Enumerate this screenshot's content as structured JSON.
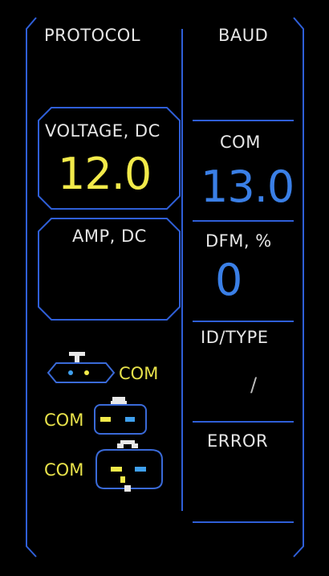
{
  "colors": {
    "frame": "#2f5fd8",
    "voltage_value": "#f2ea4a",
    "com_value": "#3a7fe6",
    "dfm_value": "#3a7fe6",
    "connector_label": "#e8e24a",
    "pin_yellow": "#f2ea4a",
    "pin_blue": "#3fa0ee"
  },
  "header": {
    "protocol_label": "PROTOCOL",
    "baud_label": "BAUD"
  },
  "voltage": {
    "label": "VOLTAGE, DC",
    "value": "12.0"
  },
  "amp": {
    "label": "AMP, DC"
  },
  "com": {
    "label": "COM",
    "value": "13.0"
  },
  "dfm": {
    "label": "DFM, %",
    "value": "0"
  },
  "id_type": {
    "label": "ID/TYPE",
    "value": "/"
  },
  "error": {
    "label": "ERROR"
  },
  "connectors": {
    "c1_label": "COM",
    "c2_label": "COM",
    "c3_label": "COM"
  }
}
